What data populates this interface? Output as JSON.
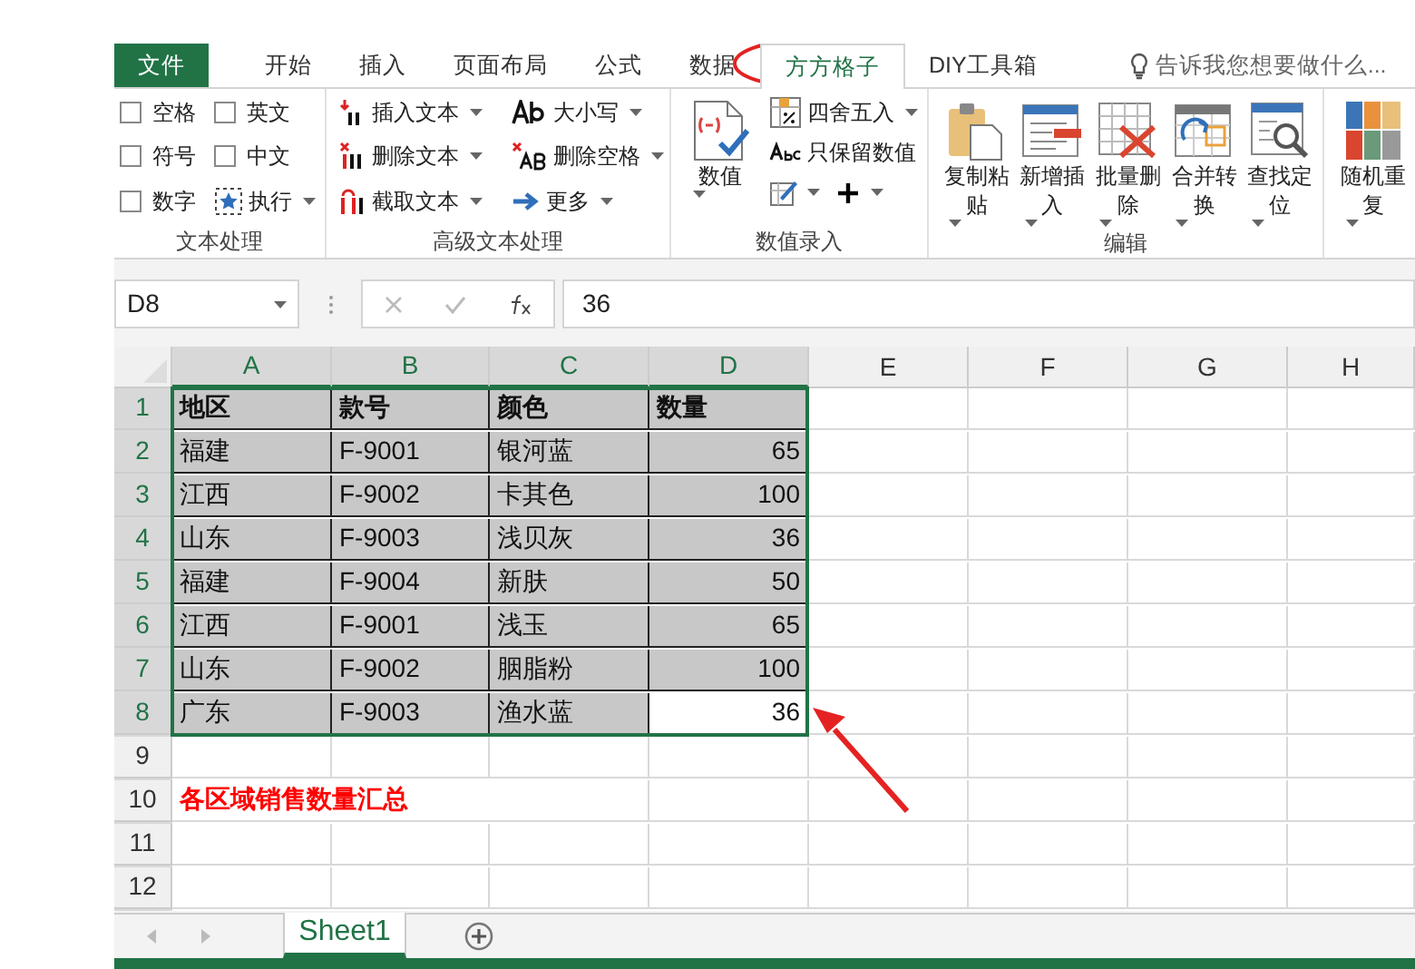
{
  "menu_tabs": [
    {
      "label": "文件",
      "kind": "file",
      "selected": false
    },
    {
      "label": "开始",
      "kind": "tab",
      "selected": false
    },
    {
      "label": "插入",
      "kind": "tab",
      "selected": false
    },
    {
      "label": "页面布局",
      "kind": "tab",
      "selected": false
    },
    {
      "label": "公式",
      "kind": "tab",
      "selected": false
    },
    {
      "label": "数据",
      "kind": "tab",
      "selected": false
    },
    {
      "label": "方方格子",
      "kind": "tab",
      "selected": true
    },
    {
      "label": "DIY工具箱",
      "kind": "tab",
      "selected": false
    }
  ],
  "tell_me": {
    "placeholder": "告诉我您想要做什么..."
  },
  "ribbon_groups": [
    {
      "label": "文本处理",
      "items": [
        {
          "kind": "checkbox",
          "label": "空格",
          "checked": false
        },
        {
          "kind": "checkbox",
          "label": "符号",
          "checked": false
        },
        {
          "kind": "checkbox",
          "label": "数字",
          "checked": false
        },
        {
          "kind": "checkbox",
          "label": "英文",
          "checked": false
        },
        {
          "kind": "checkbox",
          "label": "中文",
          "checked": false
        },
        {
          "kind": "small",
          "label": "执行",
          "dropdown": true
        }
      ]
    },
    {
      "label": "高级文本处理",
      "items": [
        {
          "kind": "small",
          "label": "插入文本",
          "dropdown": true
        },
        {
          "kind": "small",
          "label": "删除文本",
          "dropdown": true
        },
        {
          "kind": "small",
          "label": "截取文本",
          "dropdown": true
        },
        {
          "kind": "small",
          "label": "大小写",
          "dropdown": true
        },
        {
          "kind": "small",
          "label": "删除空格",
          "dropdown": true
        },
        {
          "kind": "small",
          "label": "更多",
          "dropdown": true
        }
      ]
    },
    {
      "label": "数值录入",
      "items": [
        {
          "kind": "large",
          "label": "数值",
          "dropdown": true
        },
        {
          "kind": "small",
          "label": "四舍五入",
          "dropdown": true
        },
        {
          "kind": "small",
          "label": "只保留数值",
          "dropdown": false
        },
        {
          "kind": "pair",
          "dropdown": true
        }
      ]
    },
    {
      "label": "编辑",
      "items": [
        {
          "kind": "large",
          "label": "复制粘贴",
          "dropdown": true
        },
        {
          "kind": "large",
          "label": "新增插入",
          "dropdown": true
        },
        {
          "kind": "large",
          "label": "批量删除",
          "dropdown": true
        },
        {
          "kind": "large",
          "label": "合并转换",
          "dropdown": true
        },
        {
          "kind": "large",
          "label": "查找定位",
          "dropdown": true
        }
      ]
    },
    {
      "items": [
        {
          "kind": "large",
          "label": "随机重复",
          "dropdown": true
        }
      ]
    }
  ],
  "name_box": "D8",
  "formula": "36",
  "columns": [
    {
      "label": "A",
      "selected": true
    },
    {
      "label": "B",
      "selected": true
    },
    {
      "label": "C",
      "selected": true
    },
    {
      "label": "D",
      "selected": true,
      "numeric": true
    },
    {
      "label": "E",
      "selected": false
    },
    {
      "label": "F",
      "selected": false
    },
    {
      "label": "G",
      "selected": false
    },
    {
      "label": "H",
      "selected": false
    }
  ],
  "rows": [
    {
      "number": "1",
      "kind": "header",
      "selected": true,
      "cells": [
        {
          "text": "地区",
          "active": false
        },
        {
          "text": "款号",
          "active": false
        },
        {
          "text": "颜色",
          "active": false
        },
        {
          "text": "数量",
          "active": false
        }
      ]
    },
    {
      "number": "2",
      "kind": "data",
      "selected": true,
      "cells": [
        {
          "text": "福建",
          "active": false
        },
        {
          "text": "F-9001",
          "active": false
        },
        {
          "text": "银河蓝",
          "active": false
        },
        {
          "text": "65",
          "active": false
        }
      ]
    },
    {
      "number": "3",
      "kind": "data",
      "selected": true,
      "cells": [
        {
          "text": "江西",
          "active": false
        },
        {
          "text": "F-9002",
          "active": false
        },
        {
          "text": "卡其色",
          "active": false
        },
        {
          "text": "100",
          "active": false
        }
      ]
    },
    {
      "number": "4",
      "kind": "data",
      "selected": true,
      "cells": [
        {
          "text": "山东",
          "active": false
        },
        {
          "text": "F-9003",
          "active": false
        },
        {
          "text": "浅贝灰",
          "active": false
        },
        {
          "text": "36",
          "active": false
        }
      ]
    },
    {
      "number": "5",
      "kind": "data",
      "selected": true,
      "cells": [
        {
          "text": "福建",
          "active": false
        },
        {
          "text": "F-9004",
          "active": false
        },
        {
          "text": "新肤",
          "active": false
        },
        {
          "text": "50",
          "active": false
        }
      ]
    },
    {
      "number": "6",
      "kind": "data",
      "selected": true,
      "cells": [
        {
          "text": "江西",
          "active": false
        },
        {
          "text": "F-9001",
          "active": false
        },
        {
          "text": "浅玉",
          "active": false
        },
        {
          "text": "65",
          "active": false
        }
      ]
    },
    {
      "number": "7",
      "kind": "data",
      "selected": true,
      "cells": [
        {
          "text": "山东",
          "active": false
        },
        {
          "text": "F-9002",
          "active": false
        },
        {
          "text": "胭脂粉",
          "active": false
        },
        {
          "text": "100",
          "active": false
        }
      ]
    },
    {
      "number": "8",
      "kind": "data",
      "selected": true,
      "cells": [
        {
          "text": "广东",
          "active": false
        },
        {
          "text": "F-9003",
          "active": false
        },
        {
          "text": "渔水蓝",
          "active": false
        },
        {
          "text": "36",
          "active": true
        }
      ]
    },
    {
      "number": "9",
      "kind": "data",
      "selected": false,
      "cells": []
    },
    {
      "number": "10",
      "kind": "note",
      "selected": false,
      "cells": [
        {
          "text": "各区域销售数量汇总",
          "active": false
        }
      ]
    },
    {
      "number": "11",
      "kind": "data",
      "selected": false,
      "cells": []
    },
    {
      "number": "12",
      "kind": "data",
      "selected": false,
      "cells": []
    }
  ],
  "sheet_tabs": [
    {
      "label": "Sheet1",
      "selected": true
    }
  ]
}
